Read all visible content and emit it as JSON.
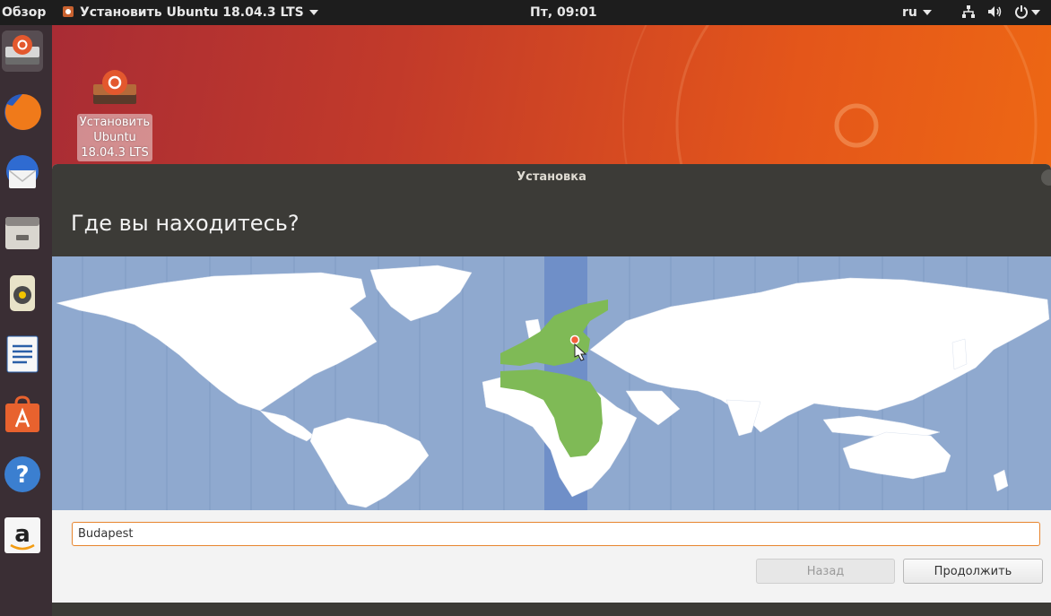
{
  "topbar": {
    "activities": "Обзор",
    "app_menu": "Установить Ubuntu 18.04.3 LTS",
    "clock": "Пт, 09:01",
    "keyboard_layout": "ru"
  },
  "dock": {
    "items": [
      "installer-icon",
      "firefox-icon",
      "thunderbird-icon",
      "files-icon",
      "rhythmbox-icon",
      "writer-icon",
      "software-icon",
      "help-icon",
      "amazon-icon"
    ]
  },
  "desktop": {
    "icon_label": "Установить Ubuntu 18.04.3 LTS"
  },
  "window": {
    "title": "Установка",
    "heading": "Где вы находитесь?",
    "timezone_input": "Budapest",
    "back_label": "Назад",
    "continue_label": "Продолжить"
  },
  "colors": {
    "ocean": "#8fa9cf",
    "land": "#ffffff",
    "selected_region": "#7fba56",
    "selected_band": "#6f8fc8",
    "input_focus": "#e7852e",
    "titlebar": "#3c3b37"
  }
}
